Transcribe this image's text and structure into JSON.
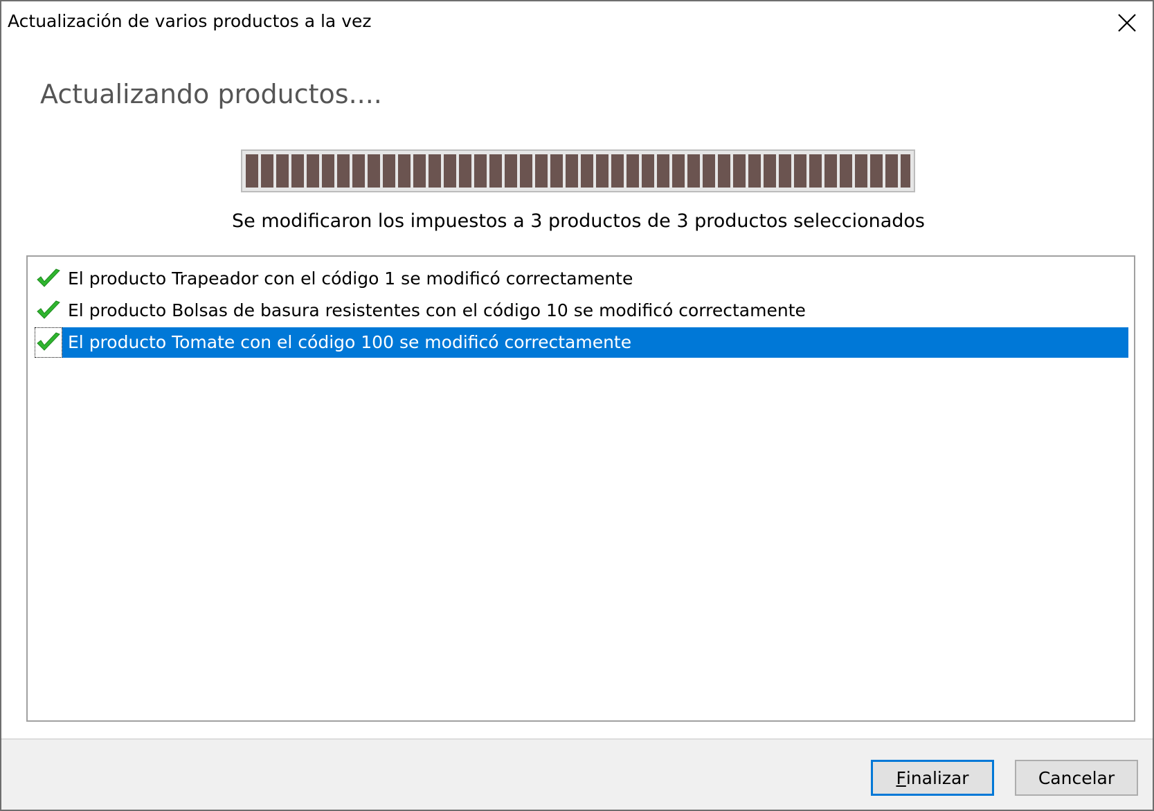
{
  "window": {
    "title": "Actualización de varios productos a la vez"
  },
  "heading": "Actualizando productos....",
  "progress": {
    "percent": 100
  },
  "status_message": "Se modificaron los impuestos a 3 productos de 3 productos seleccionados",
  "results": [
    {
      "text": "El producto Trapeador con el código 1 se modificó correctamente",
      "icon": "check-icon",
      "selected": false
    },
    {
      "text": "El producto Bolsas de basura resistentes con el código 10 se modificó correctamente",
      "icon": "check-icon",
      "selected": false
    },
    {
      "text": "El producto Tomate con el código 100 se modificó correctamente",
      "icon": "check-icon",
      "selected": true
    }
  ],
  "buttons": {
    "finalizar_accel": "F",
    "finalizar_rest": "inalizar",
    "cancelar": "Cancelar"
  },
  "colors": {
    "progress_fill": "#6b5450",
    "selection": "#0078d7",
    "check": "#2fb52f"
  }
}
